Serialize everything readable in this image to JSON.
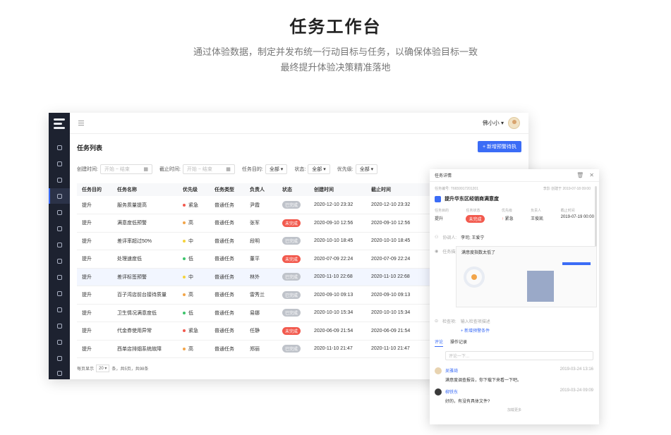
{
  "hero": {
    "title": "任务工作台",
    "subtitle_line1": "通过体验数据，制定并发布统一行动目标与任务，以确保体验目标一致",
    "subtitle_line2": "最终提升体验决策精准落地"
  },
  "topbar": {
    "user_name": "佛小小 ▾"
  },
  "page": {
    "title": "任务列表",
    "new_button": "+ 新增预警待执"
  },
  "filters": {
    "created_label": "创建时间:",
    "created_placeholder": "开始 ~ 结束",
    "deadline_label": "截止时间:",
    "deadline_placeholder": "开始 ~ 结束",
    "goal_label": "任务目的:",
    "goal_value": "全部 ▾",
    "status_label": "状态:",
    "status_value": "全部 ▾",
    "priority_label": "优先级:",
    "priority_value": "全部 ▾"
  },
  "table": {
    "headers": [
      "任务目的",
      "任务名称",
      "优先级",
      "任务类型",
      "负责人",
      "状态",
      "创建时间",
      "截止时间"
    ],
    "rows": [
      {
        "goal": "提升",
        "name": "服务质量提高",
        "priority": "紧急",
        "pcolor": "#f25a4e",
        "type": "普通任务",
        "owner": "尹霞",
        "status": "已完成",
        "done": true,
        "created": "2020-12-10 23:32",
        "deadline": "2020-12-10 23:32"
      },
      {
        "goal": "提升",
        "name": "满意度低预警",
        "priority": "高",
        "pcolor": "#f2a54a",
        "type": "普通任务",
        "owner": "张军",
        "status": "未完成",
        "done": false,
        "created": "2020-09-10 12:56",
        "deadline": "2020-09-10 12:56"
      },
      {
        "goal": "提升",
        "name": "差评率超过50%",
        "priority": "中",
        "pcolor": "#f5d33b",
        "type": "普通任务",
        "owner": "段明",
        "status": "已完成",
        "done": true,
        "created": "2020-10-10 18:45",
        "deadline": "2020-10-10 18:45"
      },
      {
        "goal": "提升",
        "name": "处理速度低",
        "priority": "低",
        "pcolor": "#3cc46b",
        "type": "普通任务",
        "owner": "董平",
        "status": "未完成",
        "done": false,
        "created": "2020-07-09 22:24",
        "deadline": "2020-07-09 22:24"
      },
      {
        "goal": "提升",
        "name": "差评标签预警",
        "priority": "中",
        "pcolor": "#f5d33b",
        "type": "普通任务",
        "owner": "林外",
        "status": "已完成",
        "done": true,
        "created": "2020-11-10 22:68",
        "deadline": "2020-11-10 22:68"
      },
      {
        "goal": "提升",
        "name": "百子湾店前台接待质量",
        "priority": "高",
        "pcolor": "#f2a54a",
        "type": "普通任务",
        "owner": "雷秀兰",
        "status": "已完成",
        "done": true,
        "created": "2020-09-10 09:13",
        "deadline": "2020-09-10 09:13"
      },
      {
        "goal": "提升",
        "name": "卫生情况满意度低",
        "priority": "低",
        "pcolor": "#3cc46b",
        "type": "普通任务",
        "owner": "易娜",
        "status": "已完成",
        "done": true,
        "created": "2020-10-10 15:34",
        "deadline": "2020-10-10 15:34"
      },
      {
        "goal": "提升",
        "name": "代金券使用异常",
        "priority": "紧急",
        "pcolor": "#f25a4e",
        "type": "普通任务",
        "owner": "任静",
        "status": "未完成",
        "done": false,
        "created": "2020-06-09 21:54",
        "deadline": "2020-06-09 21:54"
      },
      {
        "goal": "提升",
        "name": "西单店排烟系统故障",
        "priority": "高",
        "pcolor": "#f2a54a",
        "type": "普通任务",
        "owner": "郑丽",
        "status": "已完成",
        "done": true,
        "created": "2020-11-10 21:47",
        "deadline": "2020-11-10 21:47"
      }
    ]
  },
  "pager": {
    "prefix": "每页显示",
    "size": "20 ▾",
    "suffix": "条，共5页，共98条"
  },
  "panel": {
    "header": "任务详情",
    "meta_left": "任务编号: T6659917201201",
    "meta_right": "李彭  创建于 2019-07-18 09:00",
    "title": "提升华东区经销商满意度",
    "kv": [
      {
        "k": "任务目的",
        "v": "提升"
      },
      {
        "k": "任务状态",
        "v": "未完成"
      },
      {
        "k": "优先级",
        "v": "紧急"
      },
      {
        "k": "负责人",
        "v": "王俊凯"
      },
      {
        "k": "截止时间",
        "v": "2019-07-19 00:00"
      }
    ],
    "collab_label": "协调人:",
    "collab_value": "李司; 王爱宁",
    "desc_label": "任务描述:",
    "desc_value": "满意度指数太低了",
    "check_label": "检查项:",
    "check_value": "输入检查项描述",
    "add_label": "+ 新增预警条件",
    "tabs": [
      "评论",
      "操作记录"
    ],
    "comment_placeholder": "评论一下...",
    "comments": [
      {
        "name": "吴雅琦",
        "time": "2019-03-24 13:16",
        "text": "满意度调查报告，你下载下来看一下吧。"
      },
      {
        "name": "柳铁东",
        "time": "2019-03-24 09:09",
        "text": "好的，有没有具体文件?"
      }
    ],
    "more": "加载更多"
  }
}
